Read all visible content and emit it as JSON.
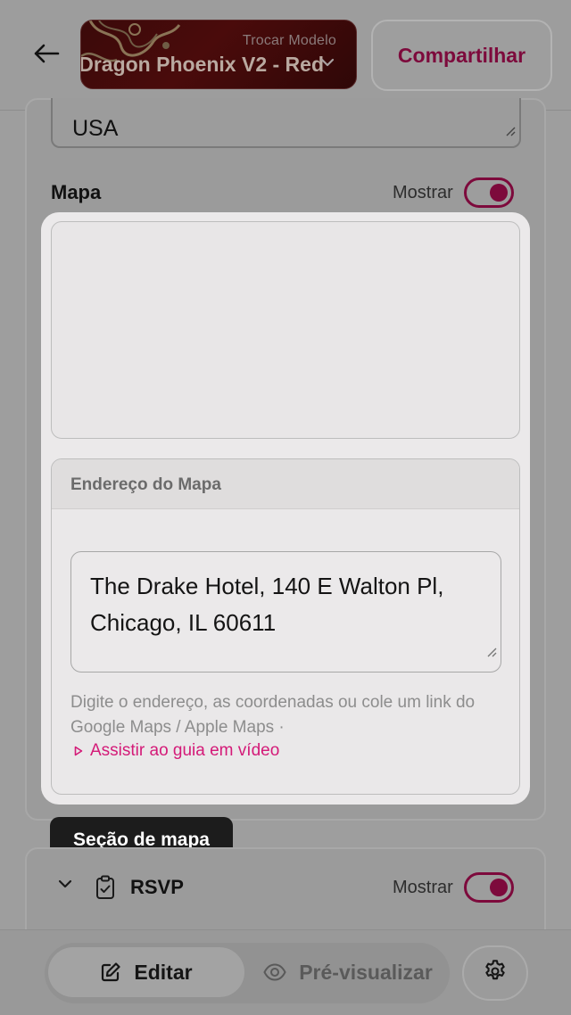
{
  "header": {
    "template_swap_label": "Trocar Modelo",
    "template_name": "Dragon Phoenix V2 - Red",
    "share_label": "Compartilhar"
  },
  "form": {
    "country_value": "USA",
    "map_section_label": "Mapa",
    "map_show_label": "Mostrar",
    "map_show_enabled": true
  },
  "map_panel": {
    "address_header": "Endereço do Mapa",
    "address_value": "The Drake Hotel, 140 E Walton Pl, Chicago, IL 60611",
    "help_text": "Digite o endereço, as coordenadas ou cole um link do Google Maps / Apple Maps ·",
    "video_link_label": "Assistir ao guia em vídeo"
  },
  "tooltip": {
    "text": "Seção de mapa"
  },
  "rsvp": {
    "label": "RSVP",
    "show_label": "Mostrar",
    "show_enabled": true
  },
  "bottom_bar": {
    "edit_label": "Editar",
    "preview_label": "Pré-visualizar"
  },
  "icons": {
    "back": "arrow-left-icon",
    "chevron": "chevron-down-icon",
    "rsvp": "clipboard-check-icon",
    "edit": "pencil-square-icon",
    "preview": "eye-icon",
    "settings": "gear-icon",
    "video": "play-triangle-icon"
  },
  "colors": {
    "accent": "#d41a78",
    "accent_dimmed": "#7d0a3c",
    "overlay_gray": "#9e9e9e",
    "panel": "#ebe9ea"
  }
}
